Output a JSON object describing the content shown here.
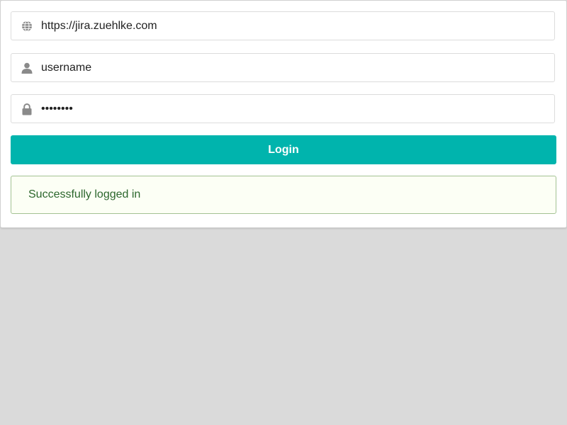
{
  "login_form": {
    "url_field": {
      "icon": "globe-icon",
      "value": "https://jira.zuehlke.com",
      "placeholder": ""
    },
    "username_field": {
      "icon": "user-icon",
      "value": "username",
      "placeholder": ""
    },
    "password_field": {
      "icon": "lock-icon",
      "value": "password",
      "placeholder": ""
    },
    "login_button": {
      "label": "Login"
    },
    "status_message": {
      "text": "Successfully logged in",
      "type": "success"
    }
  },
  "colors": {
    "accent": "#00b4ad",
    "success_text": "#2c662d",
    "success_background": "#fcfff5",
    "success_border": "#a3c293",
    "page_background": "#dadada",
    "icon": "#8a8a8a"
  }
}
